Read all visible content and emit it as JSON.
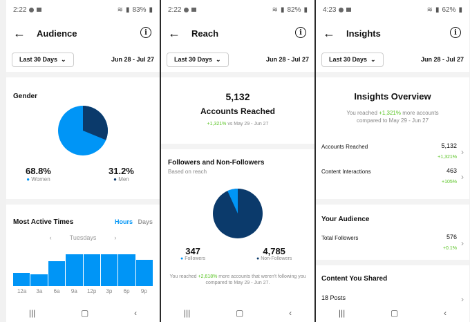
{
  "screens": [
    {
      "status": {
        "time": "2:22",
        "battery": "83%"
      },
      "title": "Audience",
      "filter": "Last 30 Days",
      "date_range": "Jun 28 - Jul 27",
      "gender": {
        "title": "Gender",
        "women_pct": "68.8%",
        "women_label": "Women",
        "men_pct": "31.2%",
        "men_label": "Men",
        "women_value": 68.8,
        "men_value": 31.2
      },
      "active_times": {
        "title": "Most Active Times",
        "tab_hours": "Hours",
        "tab_days": "Days",
        "day": "Tuesdays",
        "labels": [
          "12a",
          "3a",
          "6a",
          "9a",
          "12p",
          "3p",
          "6p",
          "9p"
        ],
        "values": [
          18,
          16,
          34,
          44,
          44,
          44,
          44,
          36
        ]
      }
    },
    {
      "status": {
        "time": "2:22",
        "battery": "82%"
      },
      "title": "Reach",
      "filter": "Last 30 Days",
      "date_range": "Jun 28 - Jul 27",
      "accounts_reached": "5,132",
      "accounts_reached_label": "Accounts Reached",
      "change": "+1,321%",
      "change_suffix": " vs May 29 - Jun 27",
      "followers_title": "Followers and Non-Followers",
      "followers_subtitle": "Based on reach",
      "followers_count": "347",
      "followers_label": "Followers",
      "non_followers_count": "4,785",
      "non_followers_label": "Non-Followers",
      "followers_value": 347,
      "non_followers_value": 4785,
      "reached_note_prefix": "You reached ",
      "reached_note_pct": "+2,618%",
      "reached_note_suffix": " more accounts that weren't following you compared to May 29 - Jun 27."
    },
    {
      "status": {
        "time": "4:23",
        "battery": "62%"
      },
      "title": "Insights",
      "filter": "Last 30 Days",
      "date_range": "Jun 28 - Jul 27",
      "overview_title": "Insights Overview",
      "overview_prefix": "You reached ",
      "overview_pct": "+1,321%",
      "overview_suffix": " more accounts compared to May 29 - Jun 27",
      "rows": [
        {
          "label": "Accounts Reached",
          "value": "5,132",
          "change": "+1,321%"
        },
        {
          "label": "Content Interactions",
          "value": "463",
          "change": "+105%"
        }
      ],
      "audience_title": "Your Audience",
      "audience_row": {
        "label": "Total Followers",
        "value": "576",
        "change": "+0.1%"
      },
      "shared_title": "Content You Shared",
      "posts": "18 Posts"
    }
  ],
  "colors": {
    "light_blue": "#0095f6",
    "dark_blue": "#0b3a6b",
    "green": "#58c322"
  },
  "icons": [
    "back-arrow-icon",
    "info-icon",
    "chevron-down-icon",
    "chevron-right-icon",
    "wifi-icon",
    "signal-icon",
    "battery-icon",
    "recents-icon",
    "home-icon",
    "back-nav-icon"
  ]
}
